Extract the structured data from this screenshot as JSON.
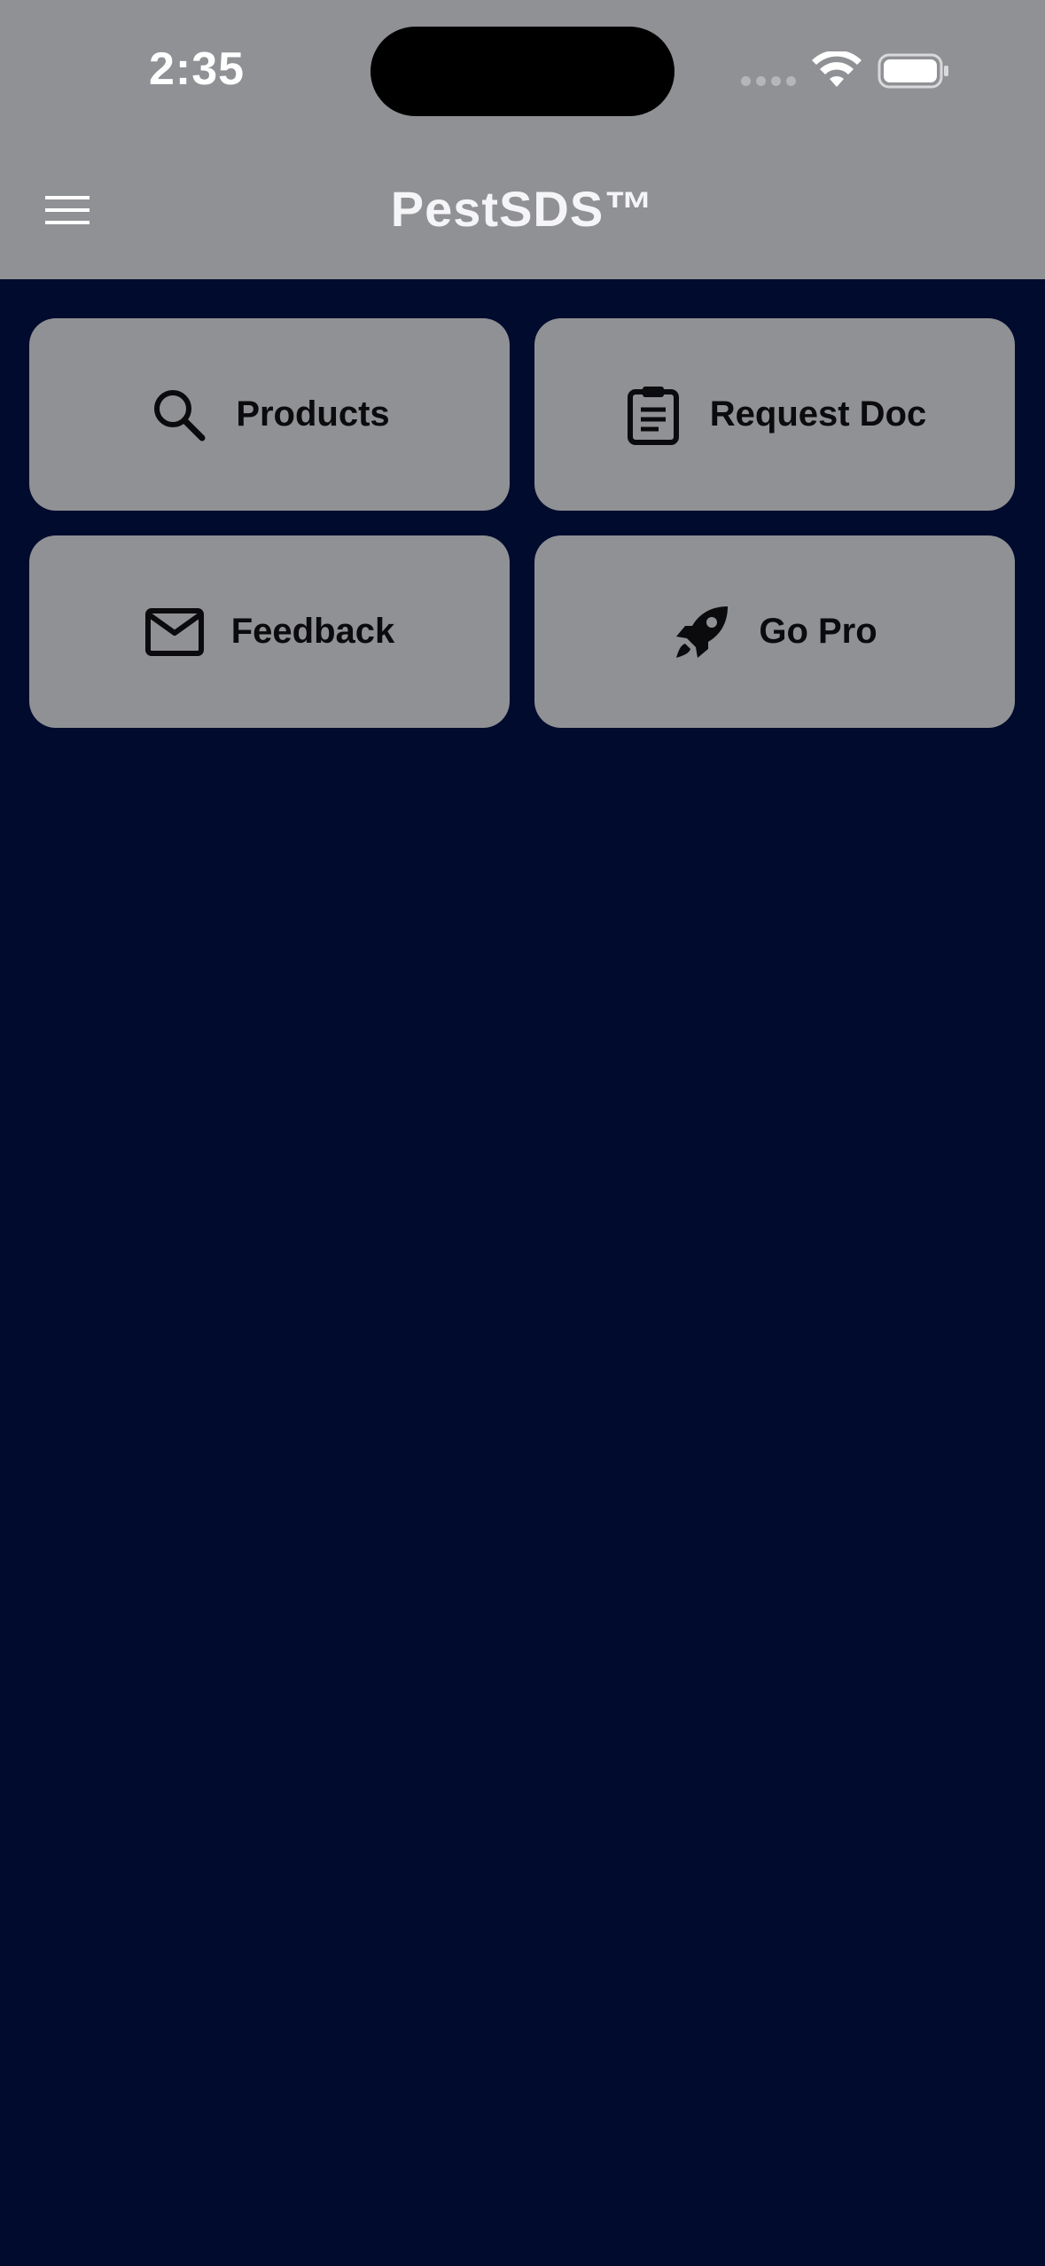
{
  "status_bar": {
    "time": "2:35"
  },
  "header": {
    "title": "PestSDS™",
    "menu_icon": "hamburger-menu-icon"
  },
  "tiles": [
    {
      "label": "Products",
      "icon": "search-icon"
    },
    {
      "label": "Request Doc",
      "icon": "clipboard-icon"
    },
    {
      "label": "Feedback",
      "icon": "mail-icon"
    },
    {
      "label": "Go Pro",
      "icon": "rocket-icon"
    }
  ],
  "colors": {
    "background": "#000b2e",
    "header": "#909194",
    "tile": "#909194",
    "tile_text": "#0b0b0d",
    "title_text": "#f5f5f7"
  }
}
